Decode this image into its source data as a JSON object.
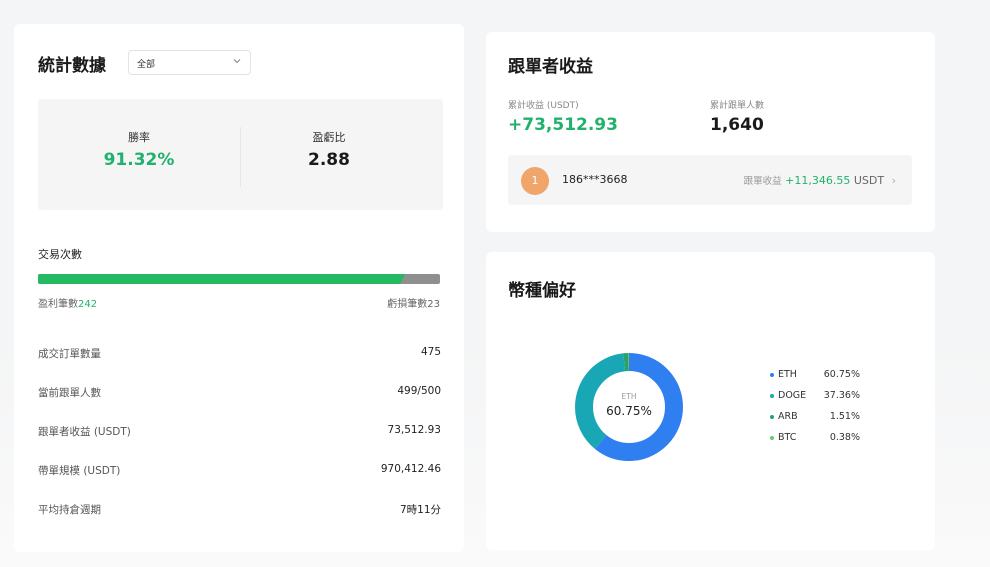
{
  "stats": {
    "title": "統計數據",
    "range_select": {
      "value": "全部",
      "icon": "chevron-down-icon"
    },
    "win_rate": {
      "label": "勝率",
      "value": "91.32%"
    },
    "profit_loss_ratio": {
      "label": "盈虧比",
      "value": "2.88"
    },
    "trades": {
      "label": "交易次數",
      "win_label": "盈利筆數",
      "win_count": "242",
      "loss_label": "虧損筆數",
      "loss_count": "23",
      "win_fraction": 0.913
    },
    "rows": [
      {
        "key": "成交訂單數量",
        "value": "475"
      },
      {
        "key": "當前跟單人數",
        "value": "499/500"
      },
      {
        "key": "跟單者收益 (USDT)",
        "value": "73,512.93"
      },
      {
        "key": "帶單規模 (USDT)",
        "value": "970,412.46"
      },
      {
        "key": "平均持倉週期",
        "value": "7時11分"
      }
    ]
  },
  "follower_earnings": {
    "title": "跟單者收益",
    "total_profit_label": "累計收益 (USDT)",
    "total_profit_value": "+73,512.93",
    "total_followers_label": "累計跟單人數",
    "total_followers_value": "1,640",
    "top_follower": {
      "rank": "1",
      "name": "186***3668",
      "earn_label": "跟單收益",
      "earn_value": "+11,346.55",
      "earn_unit": "USDT",
      "arrow": "›"
    }
  },
  "coin_preference": {
    "title": "幣種偏好",
    "center_label": "ETH",
    "center_value": "60.75%",
    "items": [
      {
        "name": "ETH",
        "pct": "60.75%",
        "value": 60.75,
        "color": "#2f7ff0"
      },
      {
        "name": "DOGE",
        "pct": "37.36%",
        "value": 37.36,
        "color": "#1aa7b5"
      },
      {
        "name": "ARB",
        "pct": "1.51%",
        "value": 1.51,
        "color": "#28a26a"
      },
      {
        "name": "BTC",
        "pct": "0.38%",
        "value": 0.38,
        "color": "#6cc66f"
      }
    ]
  },
  "colors": {
    "green": "#20b26c",
    "bar_loss": "#8f8f8f",
    "badge": "#f0a56a"
  }
}
